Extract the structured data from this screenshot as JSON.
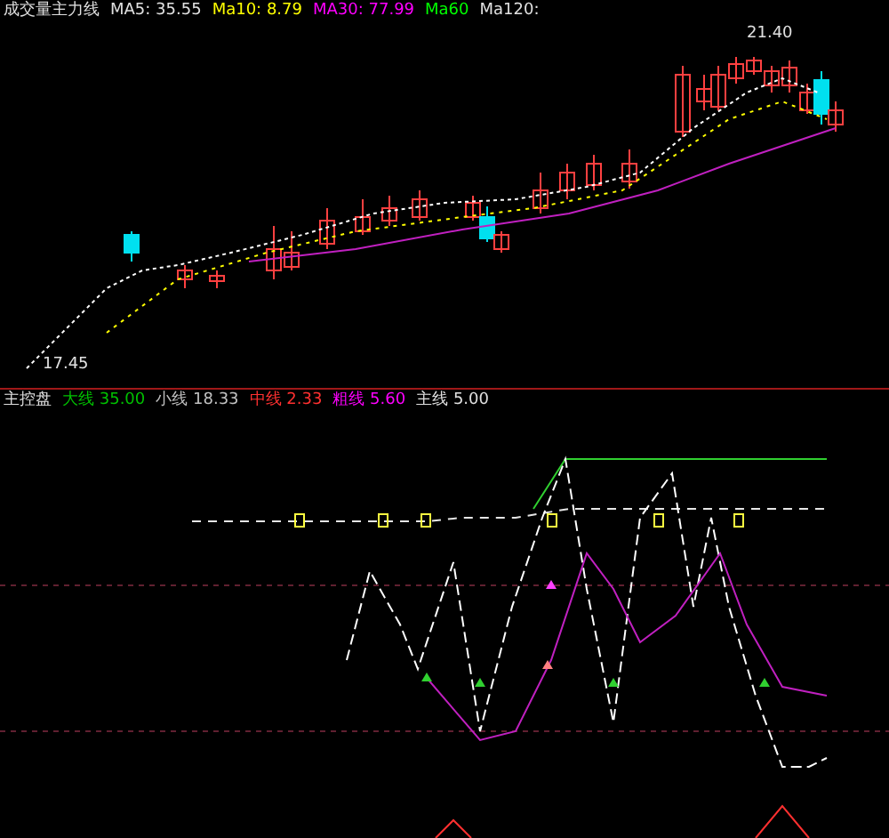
{
  "price_panel": {
    "legend": [
      {
        "text": "成交量主力线",
        "color": "#e0e0e0"
      },
      {
        "text": "MA5: 35.55",
        "color": "#e0e0e0"
      },
      {
        "text": "Ma10: 8.79",
        "color": "#ffff00"
      },
      {
        "text": "MA30: 77.99",
        "color": "#ff00ff"
      },
      {
        "text": "Ma60",
        "color": "#00ff00"
      },
      {
        "text": "Ma120:",
        "color": "#e0e0e0"
      }
    ],
    "high_label": "21.40",
    "low_label": "17.45"
  },
  "indicator_panel": {
    "legend": [
      {
        "text": "主控盘",
        "color": "#e0e0e0"
      },
      {
        "text": "大线 35.00",
        "color": "#00c000"
      },
      {
        "text": "小线 18.33",
        "color": "#c0c0c0"
      },
      {
        "text": "中线 2.33",
        "color": "#ff3030"
      },
      {
        "text": "粗线 5.60",
        "color": "#ff00ff"
      },
      {
        "text": "主线 5.00",
        "color": "#e0e0e0"
      }
    ]
  }
}
